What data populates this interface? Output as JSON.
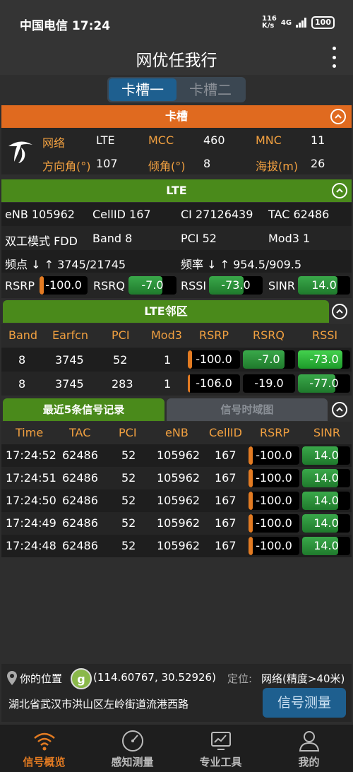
{
  "status": {
    "carrier_time": "中国电信 17:24",
    "speed": "116\nK/s",
    "network": "4G",
    "battery": "100"
  },
  "app": {
    "title": "网优任我行"
  },
  "slot_tabs": [
    "卡槽一",
    "卡槽二"
  ],
  "card": {
    "title": "卡槽",
    "network_label": "网络",
    "network_value": "LTE",
    "mcc_label": "MCC",
    "mcc_value": "460",
    "mnc_label": "MNC",
    "mnc_value": "11",
    "azimuth_label": "方向角(°)",
    "azimuth_value": "107",
    "tilt_label": "倾角(°)",
    "tilt_value": "8",
    "altitude_label": "海拔(m)",
    "altitude_value": "26"
  },
  "lte": {
    "title": "LTE",
    "enb": "eNB 105962",
    "cellid": "CellID 167",
    "ci": "CI 27126439",
    "tac": "TAC 62486",
    "duplex": "双工模式 FDD",
    "band": "Band 8",
    "pci": "PCI 52",
    "mod3": "Mod3 1",
    "earfcn": "频点 ↓ ↑ 3745/21745",
    "freq": "频率 ↓ ↑ 954.5/909.5",
    "rsrp_label": "RSRP",
    "rsrp": "-100.0",
    "rsrq_label": "RSRQ",
    "rsrq": "-7.0",
    "rssi_label": "RSSI",
    "rssi": "-73.0",
    "sinr_label": "SINR",
    "sinr": "14.0"
  },
  "neighbors": {
    "title": "LTE邻区",
    "headers": [
      "Band",
      "Earfcn",
      "PCI",
      "Mod3",
      "RSRP",
      "RSRQ",
      "RSSI"
    ],
    "rows": [
      {
        "band": "8",
        "earfcn": "3745",
        "pci": "52",
        "mod3": "1",
        "rsrp": "-100.0",
        "rsrq": "-7.0",
        "rssi": "-73.0"
      },
      {
        "band": "8",
        "earfcn": "3745",
        "pci": "283",
        "mod3": "1",
        "rsrp": "-106.0",
        "rsrq": "-19.0",
        "rssi": "-77.0"
      }
    ]
  },
  "records": {
    "tab_active": "最近5条信号记录",
    "tab_inactive": "信号时域图",
    "headers": [
      "Time",
      "TAC",
      "PCI",
      "eNB",
      "CellID",
      "RSRP",
      "SINR"
    ],
    "rows": [
      {
        "time": "17:24:52",
        "tac": "62486",
        "pci": "52",
        "enb": "105962",
        "cellid": "167",
        "rsrp": "-100.0",
        "sinr": "14.0"
      },
      {
        "time": "17:24:51",
        "tac": "62486",
        "pci": "52",
        "enb": "105962",
        "cellid": "167",
        "rsrp": "-100.0",
        "sinr": "14.0"
      },
      {
        "time": "17:24:50",
        "tac": "62486",
        "pci": "52",
        "enb": "105962",
        "cellid": "167",
        "rsrp": "-100.0",
        "sinr": "14.0"
      },
      {
        "time": "17:24:49",
        "tac": "62486",
        "pci": "52",
        "enb": "105962",
        "cellid": "167",
        "rsrp": "-100.0",
        "sinr": "14.0"
      },
      {
        "time": "17:24:48",
        "tac": "62486",
        "pci": "52",
        "enb": "105962",
        "cellid": "167",
        "rsrp": "-100.0",
        "sinr": "14.0"
      }
    ]
  },
  "location": {
    "label": "你的位置",
    "coords": "(114.60767, 30.52926)",
    "positioning_label": "定位:",
    "positioning_value": "网络(精度>40米)",
    "address": "湖北省武汉市洪山区左岭街道流港西路",
    "measure_button": "信号测量"
  },
  "nav": [
    "信号概览",
    "感知测量",
    "专业工具",
    "我的"
  ]
}
